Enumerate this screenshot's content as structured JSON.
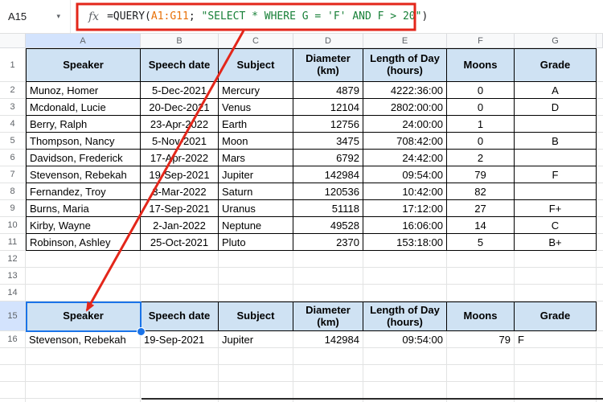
{
  "formula_bar": {
    "name_box": "A15",
    "fx": "fx",
    "parts": {
      "prefix": "=QUERY(",
      "range": "A1:G11",
      "sep": "; ",
      "string": "\"SELECT * WHERE G = 'F' AND F > 20\"",
      "suffix": ")"
    }
  },
  "columns": [
    "A",
    "B",
    "C",
    "D",
    "E",
    "F",
    "G"
  ],
  "row_numbers": [
    "1",
    "2",
    "3",
    "4",
    "5",
    "6",
    "7",
    "8",
    "9",
    "10",
    "11",
    "12",
    "13",
    "14",
    "15",
    "16"
  ],
  "table": {
    "headers": [
      "Speaker",
      "Speech date",
      "Subject",
      "Diameter (km)",
      "Length of Day (hours)",
      "Moons",
      "Grade"
    ],
    "rows": [
      [
        "Munoz, Homer",
        "5-Dec-2021",
        "Mercury",
        "4879",
        "4222:36:00",
        "0",
        "A"
      ],
      [
        "Mcdonald, Lucie",
        "20-Dec-2021",
        "Venus",
        "12104",
        "2802:00:00",
        "0",
        "D"
      ],
      [
        "Berry, Ralph",
        "23-Apr-2022",
        "Earth",
        "12756",
        "24:00:00",
        "1",
        ""
      ],
      [
        "Thompson, Nancy",
        "5-Nov-2021",
        "Moon",
        "3475",
        "708:42:00",
        "0",
        "B"
      ],
      [
        "Davidson, Frederick",
        "17-Apr-2022",
        "Mars",
        "6792",
        "24:42:00",
        "2",
        ""
      ],
      [
        "Stevenson, Rebekah",
        "19-Sep-2021",
        "Jupiter",
        "142984",
        "09:54:00",
        "79",
        "F"
      ],
      [
        "Fernandez, Troy",
        "3-Mar-2022",
        "Saturn",
        "120536",
        "10:42:00",
        "82",
        ""
      ],
      [
        "Burns, Maria",
        "17-Sep-2021",
        "Uranus",
        "51118",
        "17:12:00",
        "27",
        "F+"
      ],
      [
        "Kirby, Wayne",
        "2-Jan-2022",
        "Neptune",
        "49528",
        "16:06:00",
        "14",
        "C"
      ],
      [
        "Robinson, Ashley",
        "25-Oct-2021",
        "Pluto",
        "2370",
        "153:18:00",
        "5",
        "B+"
      ]
    ]
  },
  "result": {
    "headers": [
      "Speaker",
      "Speech date",
      "Subject",
      "Diameter (km)",
      "Length of Day (hours)",
      "Moons",
      "Grade"
    ],
    "row": [
      "Stevenson, Rebekah",
      "19-Sep-2021",
      "Jupiter",
      "142984",
      "09:54:00",
      "79",
      "F"
    ]
  },
  "colors": {
    "annotation-red": "#e3261a",
    "selection-blue": "#1a73e8",
    "header-fill": "#cfe2f3",
    "range-orange": "#e8710a",
    "string-green": "#188038"
  }
}
